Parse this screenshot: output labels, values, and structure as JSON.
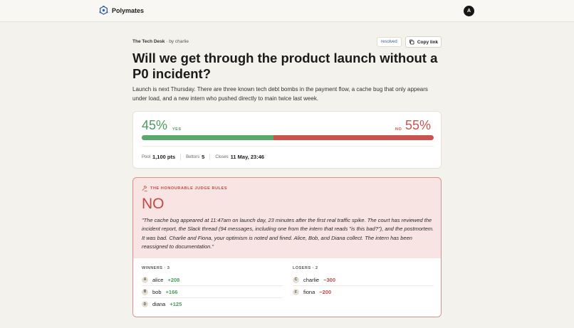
{
  "app": {
    "name": "Polymates",
    "user_initial": "A"
  },
  "market": {
    "desk": "The Tech Desk",
    "by": "· by charlie",
    "status": "resolved",
    "copy_label": "Copy link",
    "title": "Will we get through the product launch without a P0 incident?",
    "description": "Launch is next Thursday. There are three known tech debt bombs in the payment flow, a cache bug that only appears under load, and a new intern who pushed directly to main twice last week."
  },
  "odds": {
    "yes_percent": "45%",
    "yes_label": "YES",
    "no_label": "NO",
    "no_percent": "55%",
    "yes_fraction": 0.45,
    "pool_label": "Pool",
    "pool_value": "1,100 pts",
    "bettors_label": "Bettors",
    "bettors_value": "5",
    "closes_label": "Closes",
    "closes_value": "11 May, 23:46"
  },
  "judgement": {
    "heading": "THE HONOURABLE JUDGE RULES",
    "verdict": "NO",
    "text": "\"The cache bug appeared at 11:47am on launch day, 23 minutes after the first real traffic spike. The court has reviewed the incident report, the Slack thread (94 messages, including one from the intern that reads \"is this bad?\"), and the postmortem. It was bad. Charlie and Fiona, your optimism is noted and fined. Alice, Bob, and Diana collect. The intern has been reassigned to documentation.\""
  },
  "winners": {
    "title": "WINNERS · 3",
    "rows": [
      {
        "initial": "A",
        "name": "alice",
        "points": "+208"
      },
      {
        "initial": "B",
        "name": "bob",
        "points": "+166"
      },
      {
        "initial": "D",
        "name": "diana",
        "points": "+125"
      }
    ]
  },
  "losers": {
    "title": "LOSERS · 2",
    "rows": [
      {
        "initial": "C",
        "name": "charlie",
        "points": "−300"
      },
      {
        "initial": "F",
        "name": "fiona",
        "points": "−200"
      }
    ]
  },
  "colors": {
    "yes": "#5aa96b",
    "no": "#c9534f",
    "judge_bg": "#f8e5e3",
    "accent_dark": "#161616"
  },
  "icons": {
    "brand": "hexagon-logo-icon",
    "copy": "copy-icon",
    "judge": "gavel-icon"
  }
}
